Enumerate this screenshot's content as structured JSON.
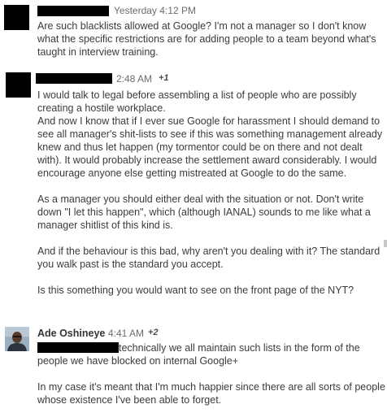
{
  "comments": [
    {
      "timestamp": "Yesterday 4:12 PM",
      "plus_ones": "",
      "author": "",
      "paragraphs": [
        "Are such blacklists allowed at Google? I'm not a manager so I don't know what the specific restrictions are for adding people to a team beyond what's taught in interview training."
      ]
    },
    {
      "timestamp": "2:48 AM",
      "plus_ones": "+1",
      "author": "",
      "paragraphs": [
        "I would talk to legal before assembling a list of people who are possibly creating a hostile workplace.",
        "And now I know that if I ever sue Google for harassment I should demand to see all manager's shit-lists to see if this was something management already knew and thus let happen (my tormentor could be on there and not dealt with). It would probably increase the settlement award considerably. I would encourage anyone else getting mistreated at Google to do the same.",
        "As a manager you should either deal with the situation or not. Don't write down \"I let this happen\", which (although IANAL) sounds to me like what a manager shitlist of this kind is.",
        "And if the behaviour is this bad, why aren't you dealing with it? The standard you walk past is the standard you accept.",
        "Is this something you would want to see on the front page of the NYT?"
      ]
    },
    {
      "timestamp": "4:41 AM",
      "plus_ones": "+2",
      "author": "Ade Oshineye",
      "paragraphs": [
        "technically we all maintain such lists in the form of the people we have blocked on internal Google+",
        "In my case it's meant that I'm much happier since there are all sorts of people whose existence I've been able to forget."
      ]
    }
  ]
}
